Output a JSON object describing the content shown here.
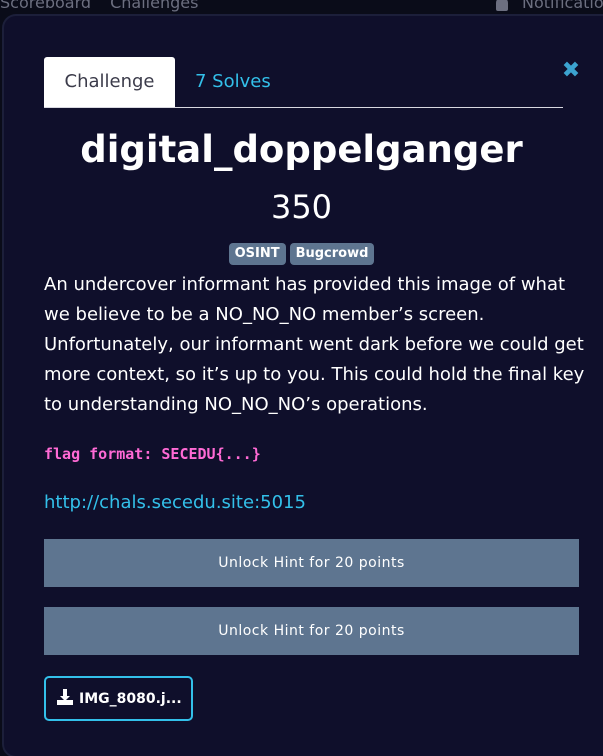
{
  "nav": {
    "left_items": [
      "Scoreboard",
      "Challenges"
    ],
    "right_item": "Notifications"
  },
  "modal": {
    "tabs": [
      {
        "label": "Challenge",
        "active": true
      },
      {
        "label": "7 Solves",
        "active": false
      }
    ],
    "close_icon": "close-icon",
    "title": "digital_doppelganger",
    "points": "350",
    "tags": [
      "OSINT",
      "Bugcrowd"
    ],
    "description": "An undercover informant has provided this image of what we believe to be a NO_NO_NO member’s screen. Unfortunately, our informant went dark before we could get more context, so it’s up to you. This could hold the final key to understanding NO_NO_NO’s operations.",
    "flag_format": "flag format: SECEDU{...}",
    "link": "http://chals.secedu.site:5015",
    "hints": [
      "Unlock Hint for 20 points",
      "Unlock Hint for 20 points"
    ],
    "file": {
      "label": "IMG_8080.j...",
      "icon": "download-icon"
    }
  },
  "colors": {
    "background": "#0a0c19",
    "modal": "#0f0f2b",
    "accent": "#33c0ea",
    "button": "#5e7590",
    "flag": "#ff6ad5"
  }
}
